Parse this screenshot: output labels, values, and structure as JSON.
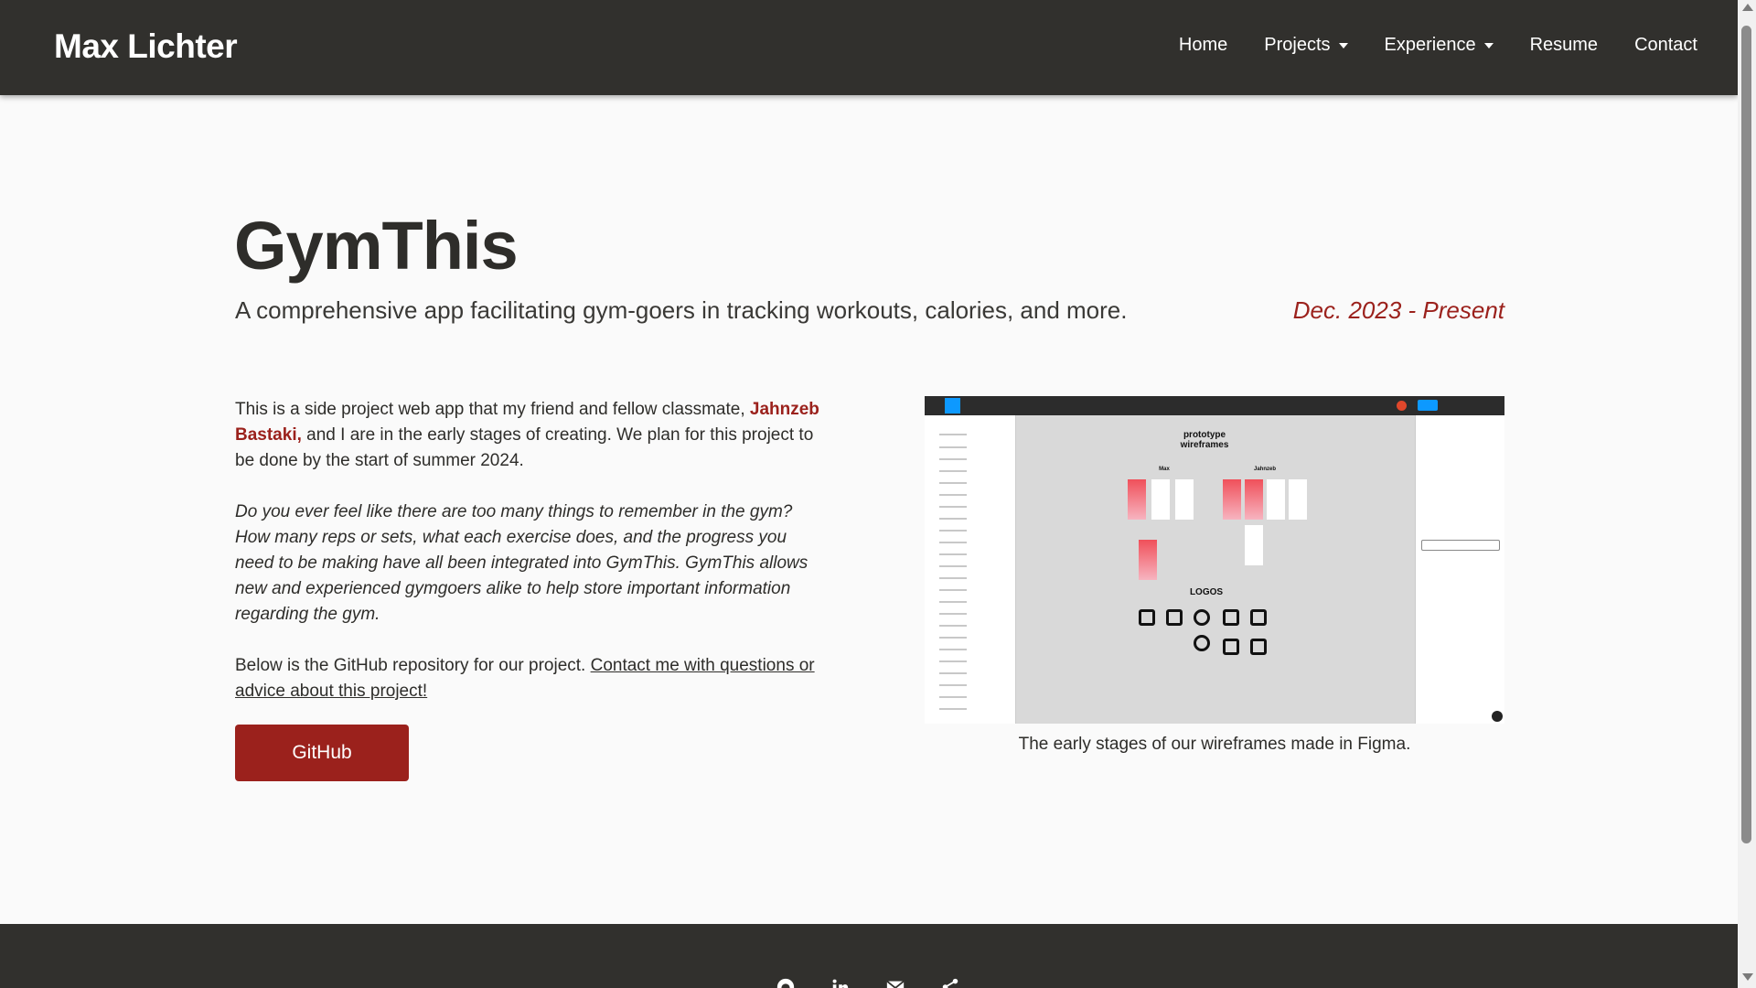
{
  "navbar": {
    "brand": "Max Lichter",
    "items": [
      {
        "label": "Home",
        "dropdown": false
      },
      {
        "label": "Projects",
        "dropdown": true
      },
      {
        "label": "Experience",
        "dropdown": true
      },
      {
        "label": "Resume",
        "dropdown": false
      },
      {
        "label": "Contact",
        "dropdown": false
      }
    ]
  },
  "project": {
    "title": "GymThis",
    "subtitle": "A comprehensive app facilitating gym-goers in tracking workouts, calories, and more.",
    "date": "Dec. 2023 - Present",
    "intro_before": "This is a side project web app that my friend and fellow classmate, ",
    "collaborator": "Jahnzeb Bastaki,",
    "intro_after": " and I are in the early stages of creating. We plan for this project to be done by the start of summer 2024.",
    "italic_paragraph": "Do you ever feel like there are too many things to remember in the gym? How many reps or sets, what each exercise does, and the progress you need to be making have all been integrated into GymThis. GymThis allows new and experienced gymgoers alike to help store important information regarding the gym.",
    "repo_text": "Below is the GitHub repository for our project. ",
    "contact_link": "Contact me with questions or advice about this project!",
    "github_button": "GitHub"
  },
  "figure": {
    "screenshot_labels": {
      "section_prototype": "prototype wireframes",
      "group_max": "Max",
      "group_jahnzeb": "Jahnzeb",
      "section_logos": "LOGOS"
    },
    "caption": "The early stages of our wireframes made in Figma."
  },
  "footer": {
    "icons": [
      "github-icon",
      "linkedin-icon",
      "email-icon",
      "share-icon"
    ]
  },
  "colors": {
    "navbar_bg": "#31302d",
    "accent": "#9b211c",
    "page_bg": "#fafafa",
    "text": "#2e2d2a"
  }
}
